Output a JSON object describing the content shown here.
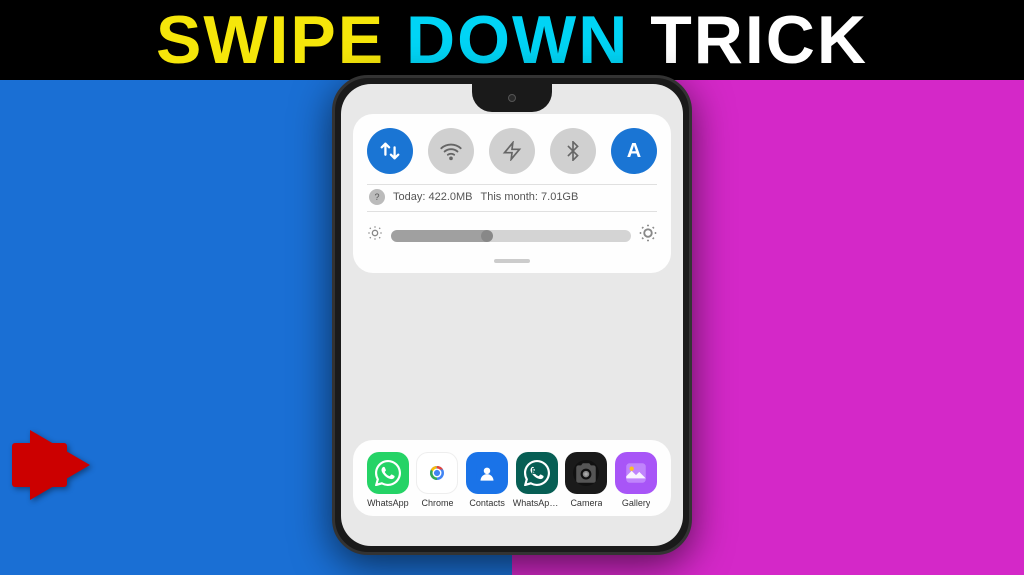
{
  "title": {
    "word1": "SWIPE",
    "word2": "DOWN",
    "word3": "TRICK"
  },
  "phone": {
    "data_today": "Today: 422.0MB",
    "data_month": "This month: 7.01GB"
  },
  "toggles": [
    {
      "id": "data",
      "label": "Data",
      "active": true,
      "icon": "⇅"
    },
    {
      "id": "wifi",
      "label": "WiFi",
      "active": false,
      "icon": "wifi"
    },
    {
      "id": "flashlight",
      "label": "Flashlight",
      "active": false,
      "icon": "flashlight"
    },
    {
      "id": "bluetooth",
      "label": "Bluetooth",
      "active": false,
      "icon": "bluetooth"
    },
    {
      "id": "auto-brightness",
      "label": "Auto",
      "active": true,
      "icon": "A"
    }
  ],
  "apps": [
    {
      "id": "whatsapp",
      "label": "WhatsApp",
      "color": "#25d366"
    },
    {
      "id": "chrome",
      "label": "Chrome",
      "color": "#ffffff"
    },
    {
      "id": "contacts",
      "label": "Contacts",
      "color": "#1a73e8"
    },
    {
      "id": "whatsapp-b",
      "label": "WhatsApp _",
      "color": "#075e54"
    },
    {
      "id": "camera",
      "label": "Camera",
      "color": "#1a1a1a"
    },
    {
      "id": "gallery",
      "label": "Gallery",
      "color": "#a855f7"
    }
  ]
}
